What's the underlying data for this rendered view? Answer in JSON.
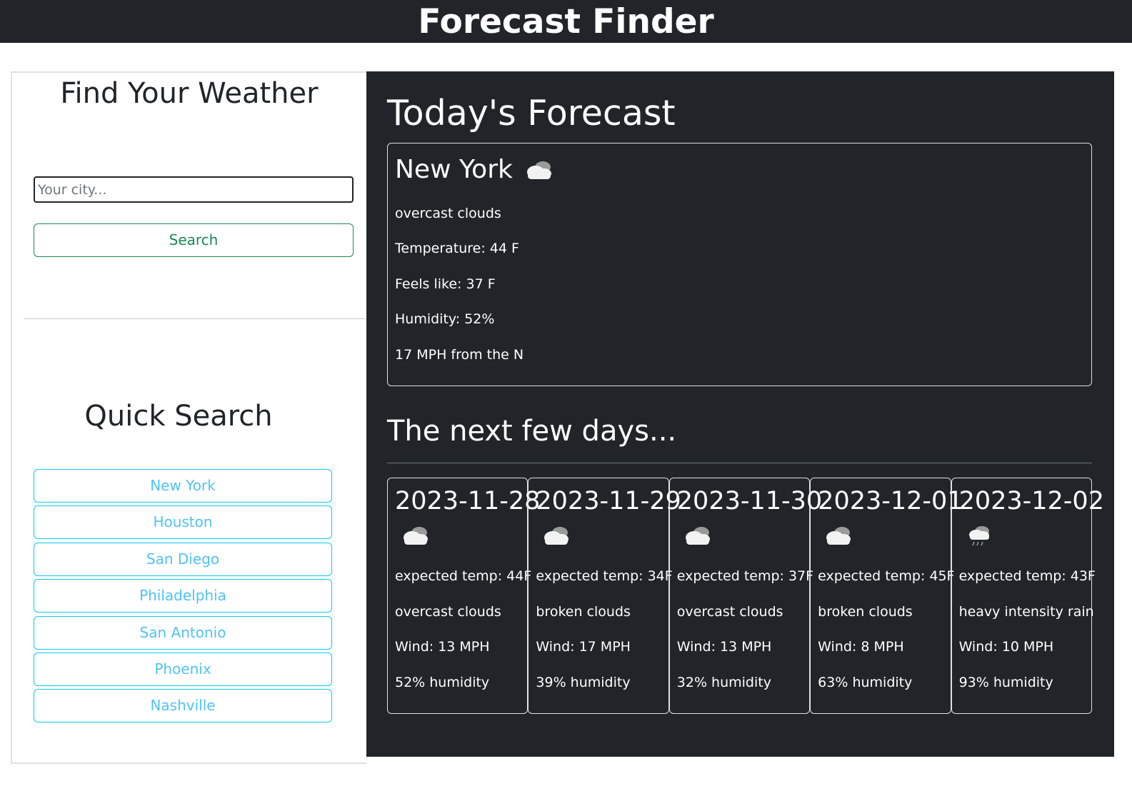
{
  "app": {
    "title": "Forecast Finder"
  },
  "sidebar": {
    "find_title": "Find Your Weather",
    "search": {
      "placeholder": "Your city...",
      "value": ""
    },
    "search_button": "Search",
    "quick_title": "Quick Search",
    "quick_cities": [
      "New York",
      "Houston",
      "San Diego",
      "Philadelphia",
      "San Antonio",
      "Phoenix",
      "Nashville"
    ]
  },
  "today": {
    "heading": "Today's Forecast",
    "city": "New York",
    "icon": "overcast-clouds-icon",
    "description": "overcast clouds",
    "temperature": "Temperature: 44 F",
    "feels_like": "Feels like: 37 F",
    "humidity": "Humidity: 52%",
    "wind": "17 MPH from the N"
  },
  "forecast": {
    "heading": "The next few days...",
    "days": [
      {
        "date": "2023-11-28",
        "icon": "overcast-clouds-icon",
        "temp": "expected temp: 44F",
        "description": "overcast clouds",
        "wind": "Wind: 13 MPH",
        "humidity": "52% humidity"
      },
      {
        "date": "2023-11-29",
        "icon": "broken-clouds-icon",
        "temp": "expected temp: 34F",
        "description": "broken clouds",
        "wind": "Wind: 17 MPH",
        "humidity": "39% humidity"
      },
      {
        "date": "2023-11-30",
        "icon": "overcast-clouds-icon",
        "temp": "expected temp: 37F",
        "description": "overcast clouds",
        "wind": "Wind: 13 MPH",
        "humidity": "32% humidity"
      },
      {
        "date": "2023-12-01",
        "icon": "broken-clouds-icon",
        "temp": "expected temp: 45F",
        "description": "broken clouds",
        "wind": "Wind: 8 MPH",
        "humidity": "63% humidity"
      },
      {
        "date": "2023-12-02",
        "icon": "rain-icon",
        "temp": "expected temp: 43F",
        "description": "heavy intensity rain",
        "wind": "Wind: 10 MPH",
        "humidity": "93% humidity"
      }
    ]
  },
  "colors": {
    "dark": "#212529",
    "success": "#198754",
    "info": "#0dcaf0",
    "border_light": "#dee2e6"
  }
}
